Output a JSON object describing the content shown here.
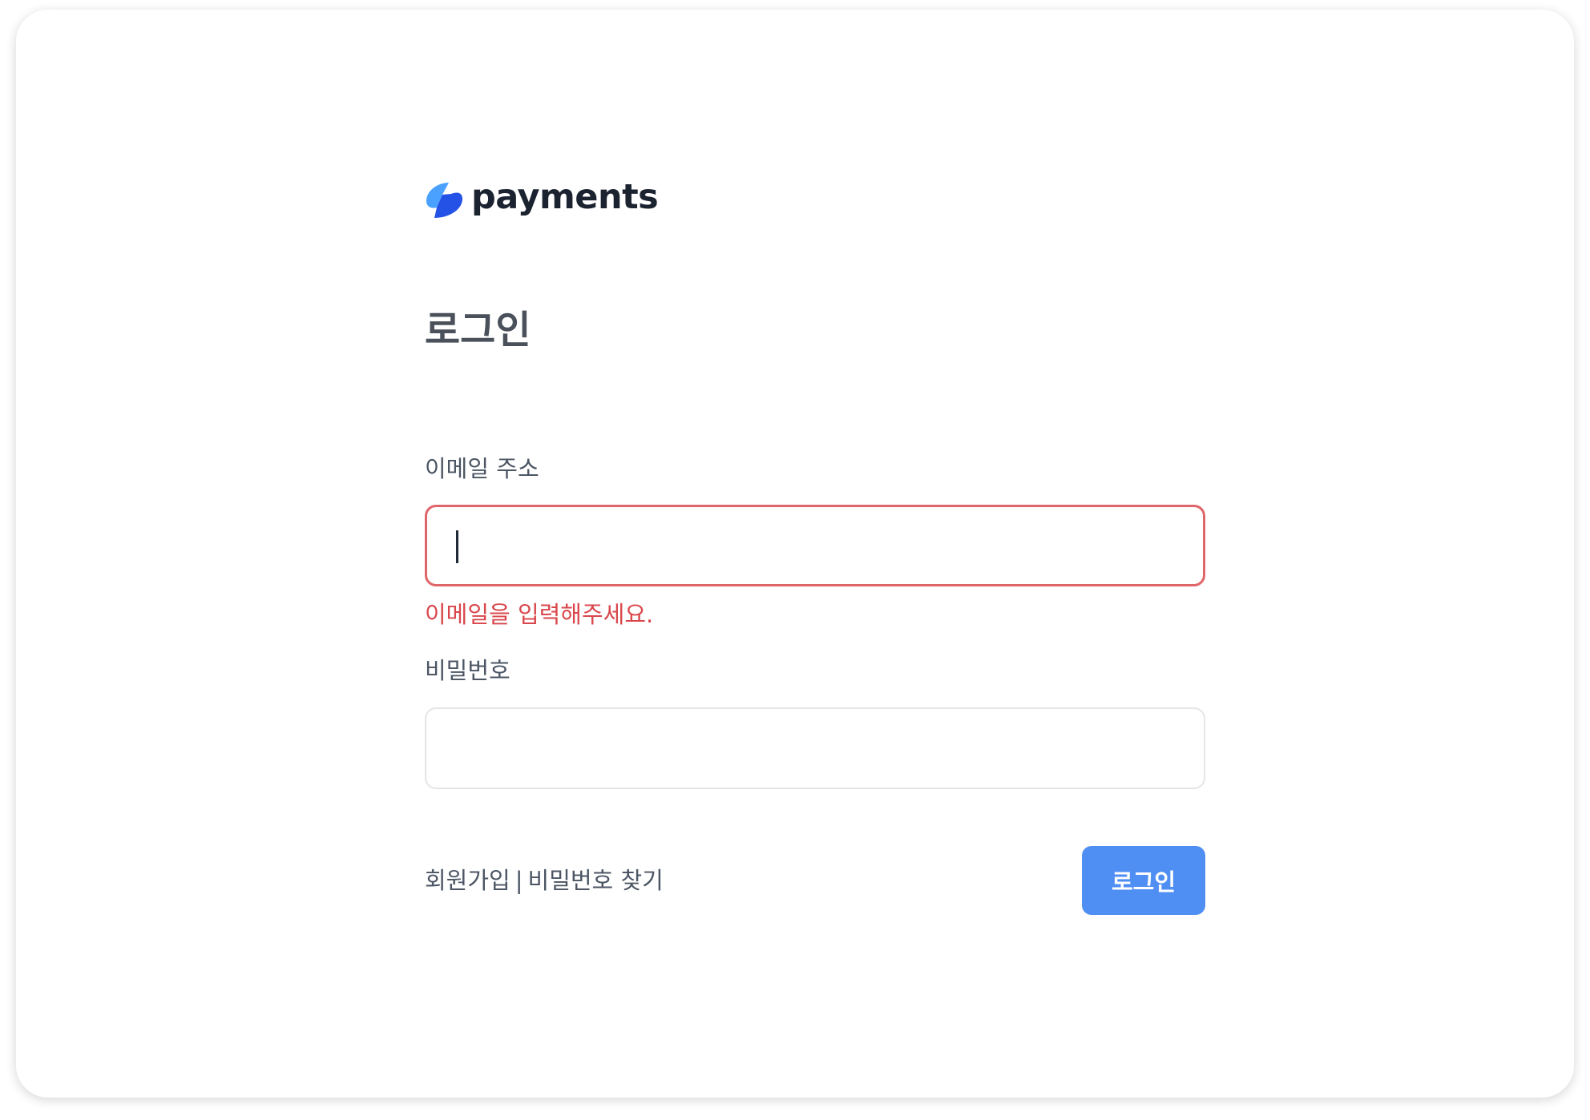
{
  "brand": {
    "name": "payments",
    "icon": "payments-logo-icon",
    "colors": {
      "logo_light": "#4aa1ff",
      "logo_dark": "#2452e6"
    }
  },
  "page": {
    "title": "로그인"
  },
  "form": {
    "email": {
      "label": "이메일 주소",
      "value": "",
      "placeholder": "",
      "error": "이메일을 입력해주세요.",
      "state": "error",
      "focused": true
    },
    "password": {
      "label": "비밀번호",
      "value": "",
      "placeholder": ""
    }
  },
  "footer": {
    "signup_link": "회원가입",
    "separator": "|",
    "find_password_link": "비밀번호 찾기",
    "submit_label": "로그인"
  },
  "colors": {
    "primary": "#4f8ef3",
    "error": "#d9474c",
    "error_border": "#e06569",
    "text": "#4b5563"
  }
}
